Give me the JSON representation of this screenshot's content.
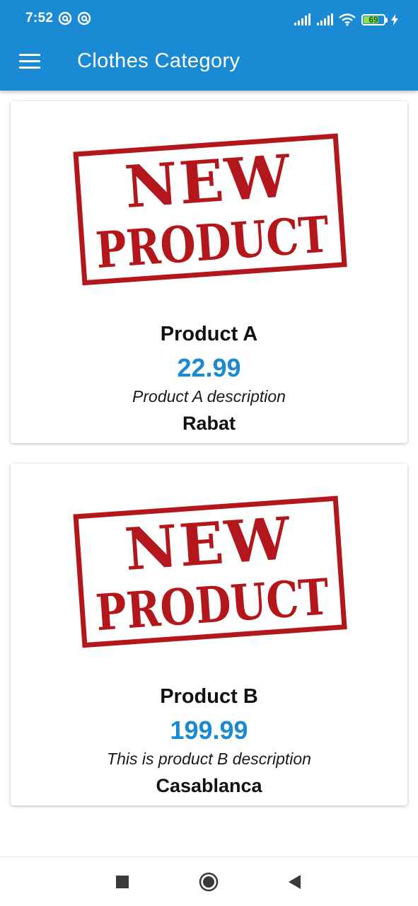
{
  "status_bar": {
    "time": "7:52",
    "battery_level": "69",
    "icons": [
      "at-sign-icon",
      "at-sign-icon",
      "signal-icon",
      "signal-icon",
      "wifi-icon",
      "battery-icon",
      "charging-bolt-icon"
    ]
  },
  "app_bar": {
    "title": "Clothes Category",
    "menu_icon": "hamburger-menu-icon"
  },
  "products": [
    {
      "stamp_line1": "NEW",
      "stamp_line2": "PRODUCT",
      "name": "Product A",
      "price": "22.99",
      "description": "Product A description",
      "city": "Rabat"
    },
    {
      "stamp_line1": "NEW",
      "stamp_line2": "PRODUCT",
      "name": "Product B",
      "price": "199.99",
      "description": "This is product B description",
      "city": "Casablanca"
    }
  ],
  "nav_bar": {
    "buttons": [
      "recents-square-icon",
      "home-circle-icon",
      "back-triangle-icon"
    ]
  },
  "colors": {
    "primary": "#1a8ad4",
    "stamp_red": "#b3161b",
    "price_blue": "#1a8ad4",
    "battery_green": "#8fe04a"
  }
}
